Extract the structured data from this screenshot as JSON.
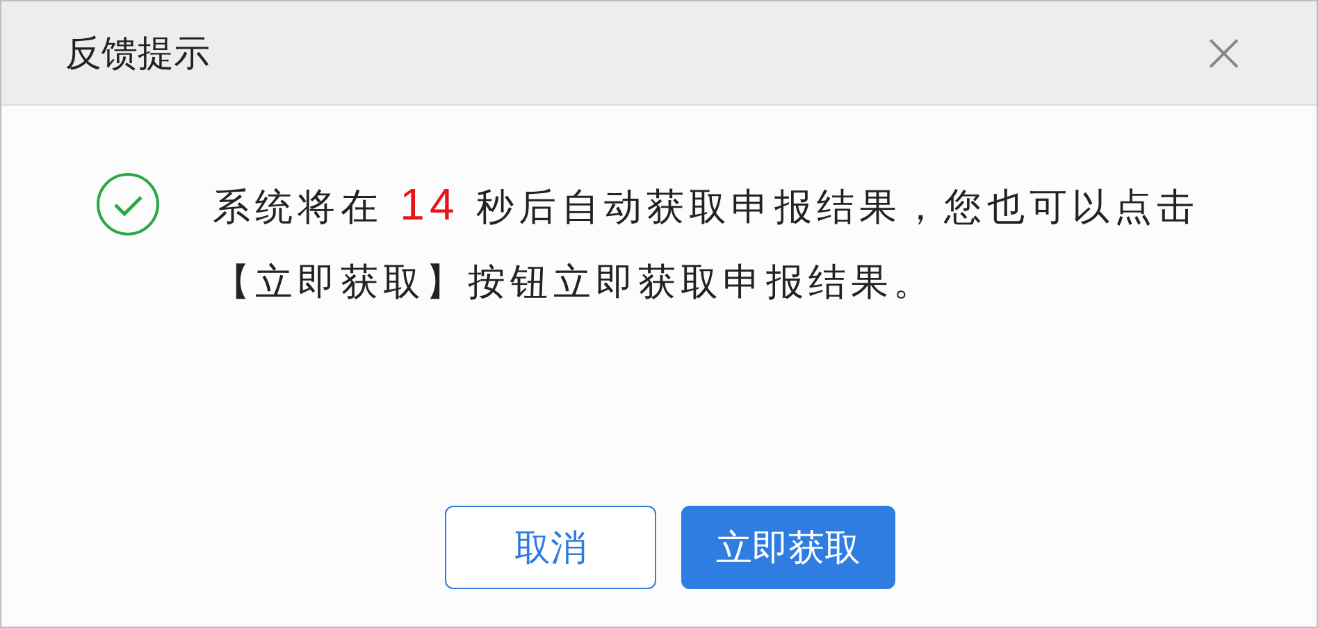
{
  "dialog": {
    "title": "反馈提示",
    "close": "×",
    "message": "系统将在 **14** 秒后自动获取申报结果，您也可以点击【立即获取】按钮立即获取申报结果。",
    "buttons": [
      {
        "label": "取消",
        "kind": "secondary"
      },
      {
        "label": "立即获取",
        "kind": "primary"
      }
    ]
  }
}
